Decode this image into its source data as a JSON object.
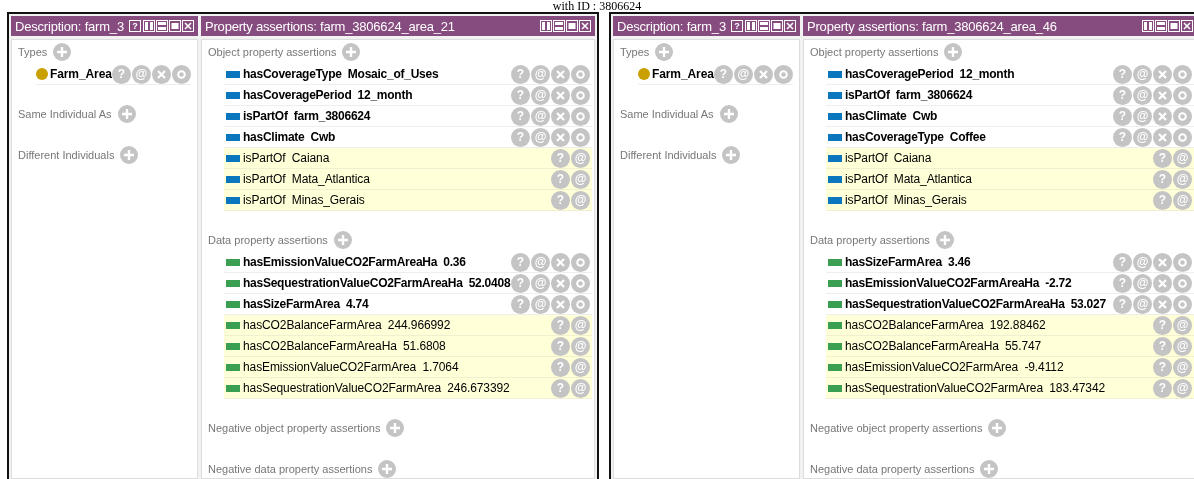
{
  "caption": "with ID : 3806624",
  "views": [
    {
      "description": {
        "title": "Description: farm_3",
        "help": "?",
        "sections": [
          {
            "label": "Types",
            "items": [
              {
                "text": "Farm_Area",
                "actions": [
                  "?",
                  "@"
                ]
              }
            ]
          },
          {
            "label": "Same Individual As"
          },
          {
            "label": "Different Individuals"
          }
        ]
      },
      "assertions": {
        "title": "Property assertions: farm_3806624_area_21",
        "sections": [
          {
            "label": "Object property assertions",
            "kind": "object",
            "rows": [
              {
                "text": "hasCoverageType Mosaic_of_Uses",
                "inferred": false,
                "actions": [
                  "?",
                  "@"
                ]
              },
              {
                "text": "hasCoveragePeriod 12_month",
                "inferred": false,
                "actions": [
                  "?",
                  "@"
                ]
              },
              {
                "text": "isPartOf farm_3806624",
                "inferred": false,
                "actions": [
                  "?",
                  "@"
                ]
              },
              {
                "text": "hasClimate Cwb",
                "inferred": false,
                "actions": [
                  "?",
                  "@"
                ]
              },
              {
                "text": "isPartOf Caiana",
                "inferred": true,
                "actions": [
                  "?",
                  "@"
                ]
              },
              {
                "text": "isPartOf Mata_Atlantica",
                "inferred": true,
                "actions": [
                  "?",
                  "@"
                ]
              },
              {
                "text": "isPartOf Minas_Gerais",
                "inferred": true,
                "actions": [
                  "?",
                  "@"
                ]
              }
            ]
          },
          {
            "label": "Data property assertions",
            "kind": "data",
            "rows": [
              {
                "text": "hasEmissionValueCO2FarmAreaHa 0.36",
                "inferred": false,
                "actions": [
                  "?",
                  "@"
                ]
              },
              {
                "text": "hasSequestrationValueCO2FarmAreaHa 52.0408",
                "inferred": false,
                "actions": [
                  "?",
                  "@"
                ]
              },
              {
                "text": "hasSizeFarmArea 4.74",
                "inferred": false,
                "actions": [
                  "?",
                  "@"
                ]
              },
              {
                "text": "hasCO2BalanceFarmArea 244.966992",
                "inferred": true,
                "actions": [
                  "?",
                  "@"
                ]
              },
              {
                "text": "hasCO2BalanceFarmAreaHa 51.6808",
                "inferred": true,
                "actions": [
                  "?",
                  "@"
                ]
              },
              {
                "text": "hasEmissionValueCO2FarmArea 1.7064",
                "inferred": true,
                "actions": [
                  "?",
                  "@"
                ]
              },
              {
                "text": "hasSequestrationValueCO2FarmArea 246.673392",
                "inferred": true,
                "actions": [
                  "?",
                  "@"
                ]
              }
            ]
          },
          {
            "label": "Negative object property assertions"
          },
          {
            "label": "Negative data property assertions"
          }
        ]
      }
    },
    {
      "description": {
        "title": "Description: farm_3",
        "help": "?",
        "sections": [
          {
            "label": "Types",
            "items": [
              {
                "text": "Farm_Area",
                "actions": [
                  "?",
                  "@"
                ]
              }
            ]
          },
          {
            "label": "Same Individual As"
          },
          {
            "label": "Different Individuals"
          }
        ]
      },
      "assertions": {
        "title": "Property assertions: farm_3806624_area_46",
        "sections": [
          {
            "label": "Object property assertions",
            "kind": "object",
            "rows": [
              {
                "text": "hasCoveragePeriod 12_month",
                "inferred": false,
                "actions": [
                  "?",
                  "@"
                ]
              },
              {
                "text": "isPartOf farm_3806624",
                "inferred": false,
                "actions": [
                  "?",
                  "@"
                ]
              },
              {
                "text": "hasClimate Cwb",
                "inferred": false,
                "actions": [
                  "?",
                  "@"
                ]
              },
              {
                "text": "hasCoverageType Coffee",
                "inferred": false,
                "actions": [
                  "?",
                  "@"
                ]
              },
              {
                "text": "isPartOf Caiana",
                "inferred": true,
                "actions": [
                  "?",
                  "@"
                ]
              },
              {
                "text": "isPartOf Mata_Atlantica",
                "inferred": true,
                "actions": [
                  "?",
                  "@"
                ]
              },
              {
                "text": "isPartOf Minas_Gerais",
                "inferred": true,
                "actions": [
                  "?",
                  "@"
                ]
              }
            ]
          },
          {
            "label": "Data property assertions",
            "kind": "data",
            "rows": [
              {
                "text": "hasSizeFarmArea 3.46",
                "inferred": false,
                "actions": [
                  "?",
                  "@"
                ]
              },
              {
                "text": "hasEmissionValueCO2FarmAreaHa -2.72",
                "inferred": false,
                "actions": [
                  "?",
                  "@"
                ]
              },
              {
                "text": "hasSequestrationValueCO2FarmAreaHa 53.027",
                "inferred": false,
                "actions": [
                  "?",
                  "@"
                ]
              },
              {
                "text": "hasCO2BalanceFarmArea 192.88462",
                "inferred": true,
                "actions": [
                  "?",
                  "@"
                ]
              },
              {
                "text": "hasCO2BalanceFarmAreaHa 55.747",
                "inferred": true,
                "actions": [
                  "?",
                  "@"
                ]
              },
              {
                "text": "hasEmissionValueCO2FarmArea -9.4112",
                "inferred": true,
                "actions": [
                  "?",
                  "@"
                ]
              },
              {
                "text": "hasSequestrationValueCO2FarmArea 183.47342",
                "inferred": true,
                "actions": [
                  "?",
                  "@"
                ]
              }
            ]
          },
          {
            "label": "Negative object property assertions"
          },
          {
            "label": "Negative data property assertions"
          }
        ]
      }
    }
  ]
}
